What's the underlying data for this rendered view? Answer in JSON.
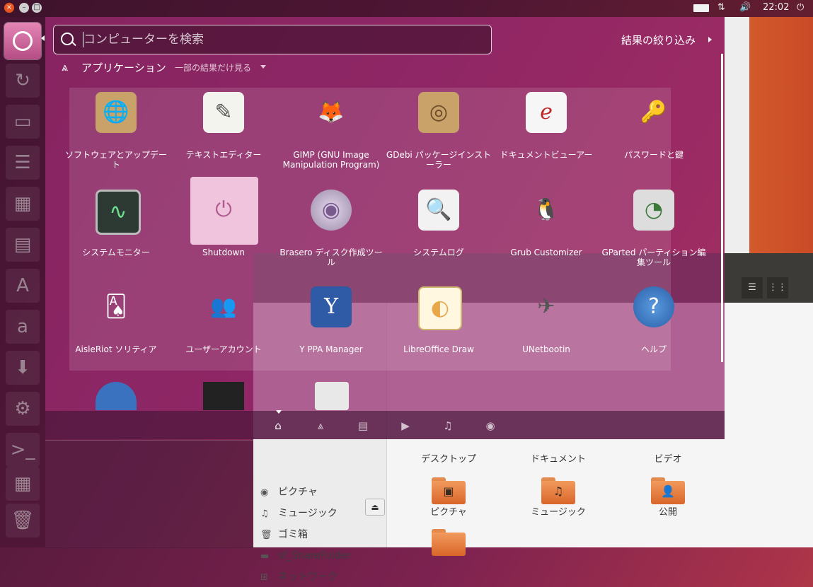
{
  "panel": {
    "time": "22:02",
    "indicators": [
      "keyboard-icon",
      "network-icon",
      "volume-icon",
      "power-icon"
    ]
  },
  "launcher": {
    "items": [
      "ubuntu-dash-icon",
      "system-updater-icon",
      "files-icon",
      "writer-icon",
      "calc-icon",
      "impress-icon",
      "software-center-icon",
      "amazon-icon",
      "updates-icon",
      "settings-icon",
      "terminal-icon",
      "workspaces-icon",
      "trash-icon"
    ]
  },
  "dash": {
    "search_placeholder": "コンピューターを検索",
    "filter_label": "結果の絞り込み",
    "category_title": "アプリケーション",
    "category_more": "一部の結果だけ見る",
    "apps": [
      {
        "label": "ソフトウェアとアップデート",
        "icon": "software-updates-icon"
      },
      {
        "label": "テキストエディター",
        "icon": "text-editor-icon"
      },
      {
        "label": "GIMP (GNU Image Manipulation Program)",
        "icon": "gimp-icon"
      },
      {
        "label": "GDebi パッケージインストーラー",
        "icon": "gdebi-icon"
      },
      {
        "label": "ドキュメントビューアー",
        "icon": "document-viewer-icon"
      },
      {
        "label": "パスワードと鍵",
        "icon": "passwords-keys-icon"
      },
      {
        "label": "システムモニター",
        "icon": "system-monitor-icon"
      },
      {
        "label": "Shutdown",
        "icon": "shutdown-icon"
      },
      {
        "label": "Brasero ディスク作成ツール",
        "icon": "brasero-icon"
      },
      {
        "label": "システムログ",
        "icon": "system-log-icon"
      },
      {
        "label": "Grub Customizer",
        "icon": "grub-customizer-icon"
      },
      {
        "label": "GParted パーティション編集ツール",
        "icon": "gparted-icon"
      },
      {
        "label": "AisleRiot ソリティア",
        "icon": "aisleriot-icon"
      },
      {
        "label": "ユーザーアカウント",
        "icon": "user-accounts-icon"
      },
      {
        "label": "Y PPA Manager",
        "icon": "y-ppa-manager-icon"
      },
      {
        "label": "LibreOffice Draw",
        "icon": "libreoffice-draw-icon"
      },
      {
        "label": "UNetbootin",
        "icon": "unetbootin-icon"
      },
      {
        "label": "ヘルプ",
        "icon": "help-icon"
      }
    ],
    "lenses": [
      "home-icon",
      "applications-icon",
      "files-icon",
      "video-icon",
      "music-icon",
      "photos-icon"
    ]
  },
  "files_window": {
    "sidebar": [
      {
        "label": "ピクチャ",
        "icon": "camera-icon"
      },
      {
        "label": "ミュージック",
        "icon": "music-icon"
      },
      {
        "label": "ゴミ箱",
        "icon": "trash-icon"
      },
      {
        "label": "sf_ShareFolder",
        "icon": "drive-icon"
      },
      {
        "label": "ネットワーク",
        "icon": "network-icon"
      }
    ],
    "folders": [
      {
        "label": "デスクトップ"
      },
      {
        "label": "ドキュメント"
      },
      {
        "label": "ビデオ"
      },
      {
        "label": "ピクチャ"
      },
      {
        "label": "ミュージック"
      },
      {
        "label": "公開"
      }
    ]
  },
  "colors": {
    "accent": "#e95420",
    "dash_tint": "#96286e"
  }
}
